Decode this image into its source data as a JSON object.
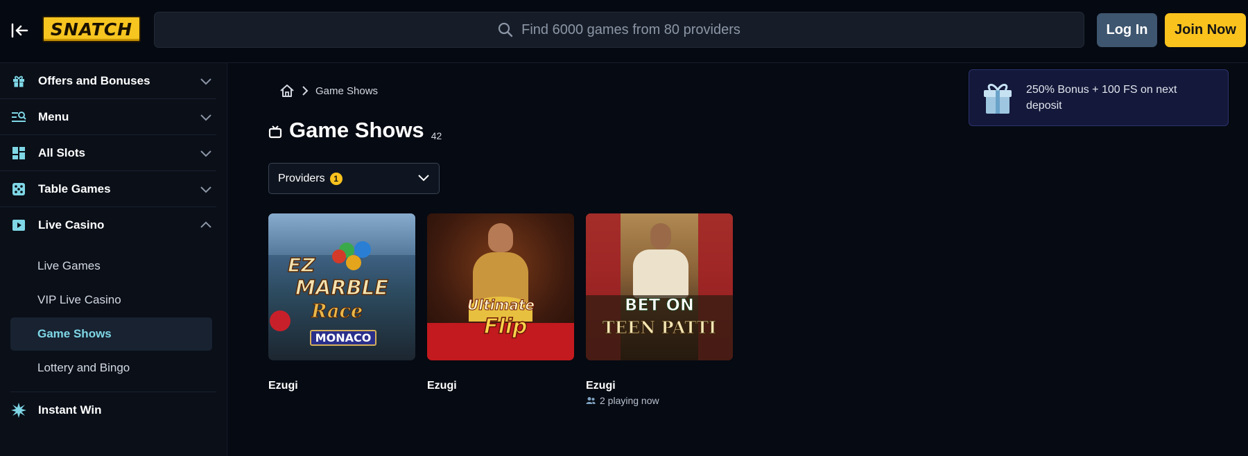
{
  "header": {
    "collapse_icon": "collapse-left-icon",
    "logo_text": "SNATCH",
    "search_placeholder": "Find 6000 games from 80 providers",
    "login_label": "Log In",
    "join_label": "Join Now"
  },
  "sidebar": {
    "items": [
      {
        "label": "Offers and Bonuses",
        "icon": "gift-icon",
        "expanded": false
      },
      {
        "label": "Menu",
        "icon": "menu-search-icon",
        "expanded": false
      },
      {
        "label": "All Slots",
        "icon": "grid-icon",
        "expanded": false
      },
      {
        "label": "Table Games",
        "icon": "dice-icon",
        "expanded": false
      },
      {
        "label": "Live Casino",
        "icon": "play-icon",
        "expanded": true
      },
      {
        "label": "Instant Win",
        "icon": "burst-icon",
        "expanded": false
      }
    ],
    "live_casino_sub": [
      "Live Games",
      "VIP Live Casino",
      "Game Shows",
      "Lottery and Bingo"
    ],
    "active_sub": "Game Shows"
  },
  "breadcrumb": {
    "home_icon": "home-icon",
    "current": "Game Shows"
  },
  "page": {
    "title": "Game Shows",
    "count": "42",
    "title_icon": "tv-icon"
  },
  "filters": {
    "providers_label": "Providers",
    "providers_count": "1"
  },
  "promo": {
    "icon": "gift-box-icon",
    "text": "250% Bonus + 100 FS on next deposit"
  },
  "games": [
    {
      "provider": "Ezugi",
      "art": [
        "EZ",
        "MARBLE",
        "Race",
        "MONACO"
      ],
      "playing": ""
    },
    {
      "provider": "Ezugi",
      "art": [
        "Ultimate",
        "Flip"
      ],
      "playing": ""
    },
    {
      "provider": "Ezugi",
      "art": [
        "BET ON",
        "TEEN PATTI"
      ],
      "playing": "2 playing now"
    }
  ],
  "colors": {
    "accent_yellow": "#f9c21d",
    "active_teal": "#7fd7e6",
    "login_blue": "#3e5670"
  }
}
